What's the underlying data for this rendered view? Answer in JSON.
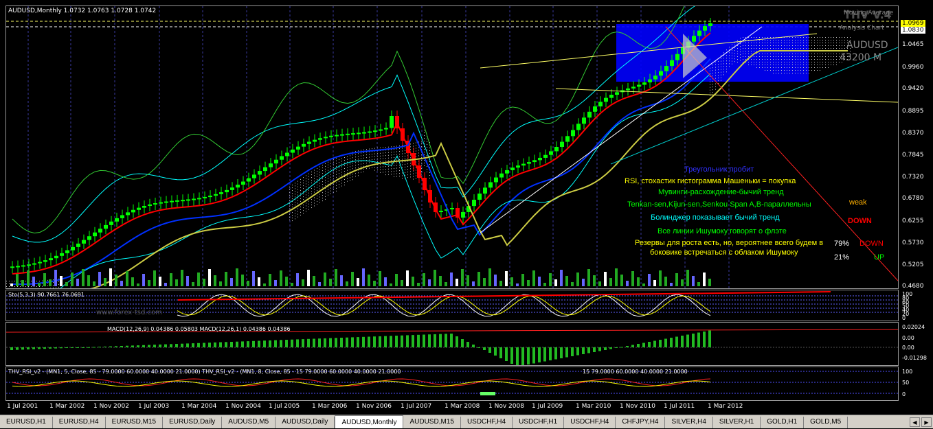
{
  "chart": {
    "header": "AUDUSD,Monthly  1.0732 1.0763 1.0728 1.0742",
    "watermark_indicator": "THV V.4",
    "overlay_small_1": "Moving Average",
    "overlay_small_2": "Analysis Chart",
    "symbol": "AUDUSD",
    "timeframe": "43200 M",
    "price_box_1": "1.0969",
    "price_box_2": "1.0830",
    "website": "www.forex-tsd.com"
  },
  "price_axis": [
    "1.0969",
    "1.0830",
    "1.0465",
    "0.9960",
    "0.9420",
    "0.8895",
    "0.8370",
    "0.7845",
    "0.7320",
    "0.6780",
    "0.6255",
    "0.5730",
    "0.5205",
    "0.4680"
  ],
  "stoch": {
    "label": "Sto(5,3,3) 90.7661 76.0691",
    "axis": [
      "100",
      "80",
      "60",
      "50",
      "40",
      "20",
      "0"
    ]
  },
  "macd": {
    "label": "MACD(12,26,9) 0.04386 0.05803  MACD(12,26,1) 0.04386 0.04386",
    "axis": [
      "0.02024",
      "0.00",
      "0.00",
      "-0.01298"
    ]
  },
  "rsi": {
    "label_left": "THV_RSI_v2 - (MN1, 5, Close, 85 - 79.0000 60.0000 40.0000 21.0000)   THV_RSI_v2 - (MN1, 8, Close, 85 - 15 79.0000 60.0000 40.0000 21.0000",
    "label_right": "15 79.0000 60.0000 40.0000 21.0000",
    "axis": [
      "100",
      "50",
      "0"
    ]
  },
  "time_axis": [
    "1 Jul 2001",
    "1 Mar 2002",
    "1 Nov 2002",
    "1 Jul 2003",
    "1 Mar 2004",
    "1 Nov 2004",
    "1 Jul 2005",
    "1 Mar 2006",
    "1 Nov 2006",
    "1 Jul 2007",
    "1 Mar 2008",
    "1 Nov 2008",
    "1 Jul 2009",
    "1 Mar 2010",
    "1 Nov 2010",
    "1 Jul 2011",
    "1 Mar 2012"
  ],
  "annotations": {
    "line1": "Треугольник пробит",
    "line2": "RSI, стохастик гистограмма Машеньки = покупка",
    "line3": "Мувинги-расхождение-бычий тренд",
    "line4": "Tenkan-sen,Kijun-sen,Senkou Span A,B-параллельны",
    "line5": "Болинджер показывает бычий тренд",
    "line6": "Все линии Ишумоку говорят о флэте",
    "line7": "Резервы для роста есть, но, вероятнее всего будем в",
    "line8": "боковике встречаться с облаком Ишумоку",
    "weak": "weak",
    "down": "DOWN",
    "pct_down": "79%",
    "pct_down_label": "DOWN",
    "pct_up": "21%",
    "pct_up_label": "UP"
  },
  "tabs": [
    "EURUSD,H1",
    "EURUSD,H4",
    "EURUSD,M15",
    "EURUSD,Daily",
    "AUDUSD,M5",
    "AUDUSD,Daily",
    "AUDUSD,Monthly",
    "AUDUSD,M15",
    "USDCHF,H4",
    "USDCHF,H1",
    "USDCHF,H4",
    "CHFJPY,H4",
    "SILVER,H4",
    "SILVER,H1",
    "GOLD,H1",
    "GOLD,M5"
  ],
  "active_tab": "AUDUSD,Monthly",
  "colors": {
    "bull": "#00ff00",
    "bear": "#ff0000",
    "tenkan": "#ff0000",
    "kijun": "#0030ff",
    "cloud": "#ffffff",
    "bollinger": "#00ffff",
    "highlight_box": "#0000ff",
    "ann_blue": "#3030ff",
    "ann_yellow": "#ffff00",
    "ann_green": "#00ff00",
    "ann_cyan": "#00ffff"
  }
}
